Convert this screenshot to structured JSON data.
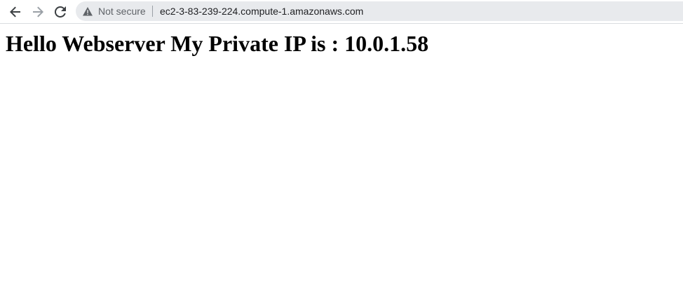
{
  "browser": {
    "security_label": "Not secure",
    "url": "ec2-3-83-239-224.compute-1.amazonaws.com",
    "icons": {
      "back": "arrow-left-icon",
      "forward": "arrow-right-icon",
      "reload": "reload-icon",
      "security": "warning-triangle-icon"
    },
    "forward_disabled": true
  },
  "page": {
    "heading": "Hello Webserver My Private IP is : 10.0.1.58"
  },
  "colors": {
    "omnibox_bg": "#e8eaed",
    "text_primary": "#202124",
    "text_secondary": "#5f6368",
    "icon_active": "#3c4043",
    "icon_disabled": "#9aa0a6"
  }
}
